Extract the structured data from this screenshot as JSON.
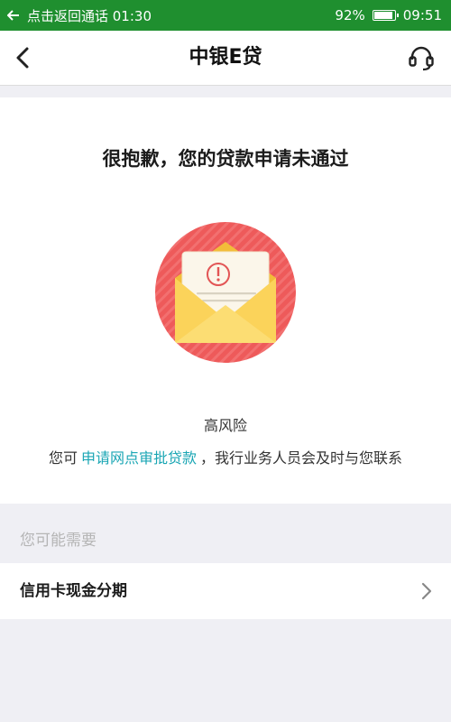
{
  "status_bar": {
    "back_call_text": "点击返回通话 01:30",
    "battery_percent": "92%",
    "battery_level": 0.92,
    "time": "09:51",
    "color": "#1f8f2f"
  },
  "nav": {
    "title": "中银E贷",
    "back_icon": "chevron-left-icon",
    "support_icon": "headset-icon"
  },
  "result": {
    "title": "很抱歉，您的贷款申请未通过",
    "illustration_icon": "rejected-envelope-icon",
    "risk_label": "高风险",
    "info_prefix": "您可",
    "info_link": "申请网点审批贷款",
    "info_suffix": "，我行业务人员会及时与您联系",
    "link_color": "#1aa6b4"
  },
  "recommendations": {
    "header": "您可能需要",
    "items": [
      {
        "label": "信用卡现金分期",
        "icon": "chevron-right-icon"
      }
    ]
  }
}
